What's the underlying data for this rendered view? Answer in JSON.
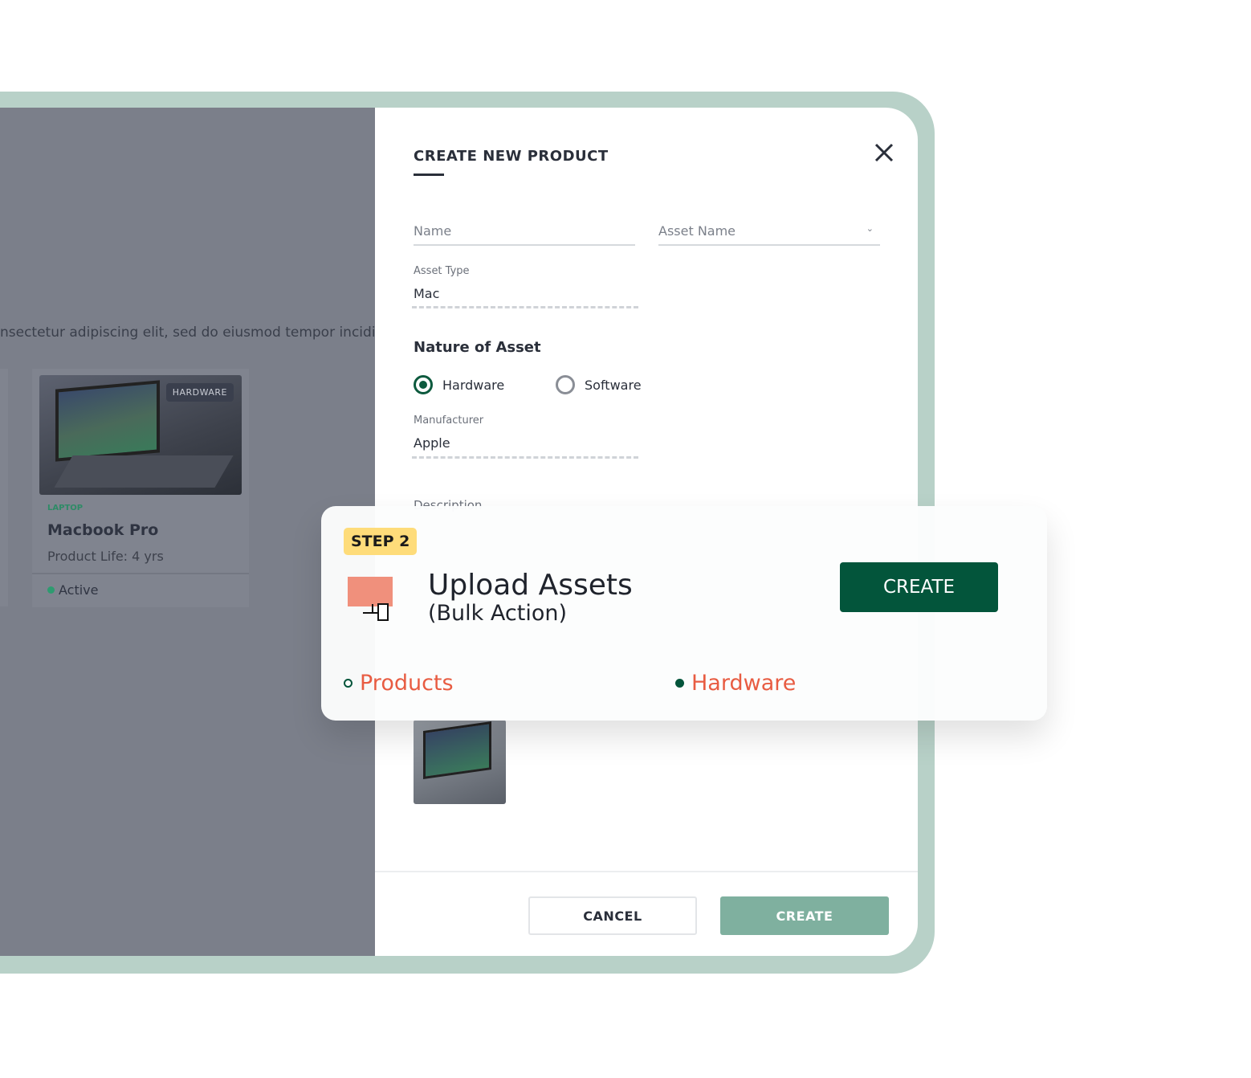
{
  "background": {
    "lorem_text": "nsectetur adipiscing elit, sed do eiusmod tempor incidid",
    "card": {
      "badge": "HARDWARE",
      "category": "LAPTOP",
      "name": "Macbook Pro",
      "life": "Product Life: 4 yrs",
      "status": "Active"
    }
  },
  "modal": {
    "title": "CREATE NEW PRODUCT",
    "name_placeholder": "Name",
    "asset_name_placeholder": "Asset Name",
    "asset_type_label": "Asset Type",
    "asset_type_value": "Mac",
    "nature_title": "Nature of Asset",
    "radios": [
      {
        "label": "Hardware",
        "selected": true
      },
      {
        "label": "Software",
        "selected": false
      }
    ],
    "manufacturer_label": "Manufacturer",
    "manufacturer_value": "Apple",
    "description_label": "Description",
    "cancel_label": "CANCEL",
    "create_label": "CREATE"
  },
  "popup": {
    "step": "STEP 2",
    "title": "Upload Assets",
    "subtitle": "(Bulk Action)",
    "create_label": "CREATE",
    "tags": [
      {
        "label": "Products"
      },
      {
        "label": "Hardware"
      }
    ]
  },
  "colors": {
    "primary": "#03553b",
    "accent": "#e85c42",
    "frame": "#b8d1c8",
    "step_badge": "#fedc7a",
    "disabled_create": "#7fb09f"
  }
}
